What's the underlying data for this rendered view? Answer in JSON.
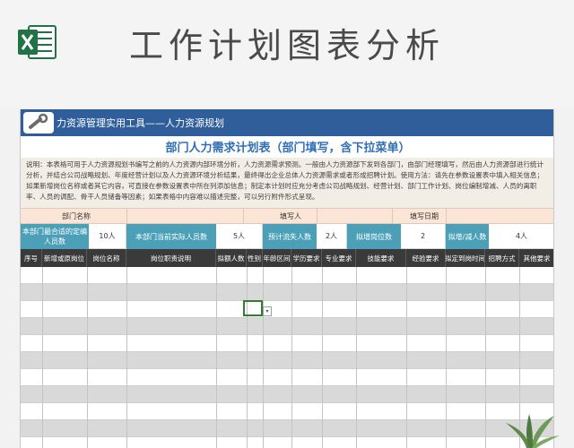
{
  "page": {
    "title": "工作计划图表分析"
  },
  "sheet": {
    "tool_header": "力资源管理实用工具——人力资源规划",
    "sub_title": "部门人力需求计划表（部门填写，含下拉菜单）",
    "description": "说明：本表格可用于人力资源规划书编写之前的人力资源内部环境分析，人力资源需求预测。一般由人力资源部下发到各部门，由部门经理填写，然后由人力资源部进行统计分析，并结合公司战略规划、年度经营计划以及人力资源环境分析结果，最终得出企业总体人力资源需求或者形成招聘计划。使用方法：请先在参数设置表中填入相关信息；如果新增岗位名称或者其它内容，可直接在参数设置表中所在列添加信息；制定本计划时应充分考虑公司战略规划、经营计划、部门工作计划、岗位编制增减、人员的离职率、人员的调配、骨干人员储备等因素；如果表格中内容难以描述完整，可以另行附件形式呈现。",
    "info_row": {
      "dept_label": "部门名称",
      "filler_label": "填写人",
      "date_label": "填写日期"
    },
    "stats": [
      {
        "label": "本部门最合适的定编人员数",
        "value": "10人"
      },
      {
        "label": "本部门当前实际人员数",
        "value": "5人"
      },
      {
        "label": "预计流失人数",
        "value": "2人"
      },
      {
        "label": "拟增岗位数",
        "value": "2"
      },
      {
        "label": "拟增/减人数",
        "value": "4人"
      }
    ],
    "columns": [
      "序号",
      "新增或原岗位",
      "岗位名称",
      "岗位职责说明",
      "拟额人数",
      "性别",
      "年龄区间",
      "学历要求",
      "专业要求",
      "技能要求",
      "经验要求",
      "拟定到岗时间",
      "招聘方式",
      "其他要求"
    ],
    "dropdown_symbol": "▾"
  },
  "colors": {
    "header_blue": "#2f5e9a",
    "subtitle_blue": "#2f6fb5",
    "stat_teal": "#4ba0b8",
    "column_header_dark": "#3a3a3a",
    "info_peach": "#fbe5d6",
    "excel_green": "#217346"
  },
  "icons": [
    "excel-logo-icon",
    "wrench-icon",
    "plant-decoration-icon"
  ]
}
